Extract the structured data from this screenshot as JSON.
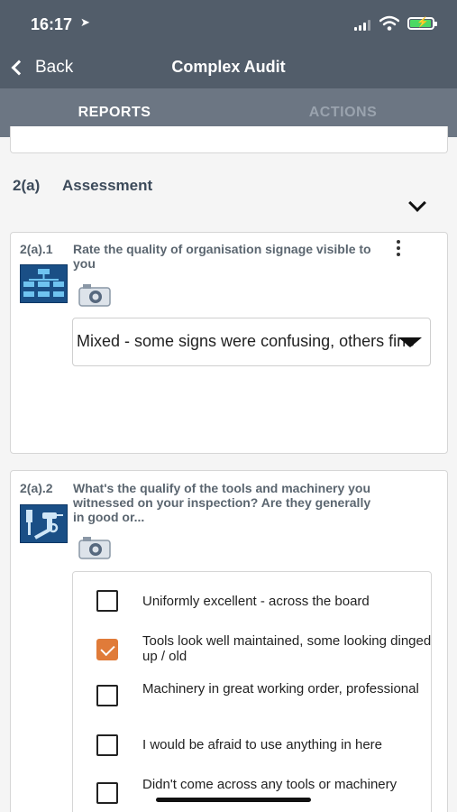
{
  "status_bar": {
    "time": "16:17"
  },
  "nav": {
    "back_label": "Back",
    "title": "Complex Audit"
  },
  "tabs": [
    {
      "label": "REPORTS",
      "active": true
    },
    {
      "label": "ACTIONS",
      "active": false
    }
  ],
  "section": {
    "code": "2(a)",
    "title": "Assessment",
    "chevron_icon": "chevron-down-icon"
  },
  "questions": [
    {
      "code": "2(a).1",
      "text": "Rate the quality of organisation signage visible to you",
      "icon": "signage-chart-icon",
      "answer_type": "select",
      "selected_value": "Mixed - some signs were confusing, others fine"
    },
    {
      "code": "2(a).2",
      "text": "What's the qualify of the tools and machinery you witnessed on your inspection? Are they generally in good or...",
      "icon": "tools-icon",
      "answer_type": "checkbox",
      "options": [
        {
          "label": "Uniformly excellent - across the board",
          "checked": false
        },
        {
          "label": "Tools look well maintained, some looking dinged up / old",
          "checked": true
        },
        {
          "label": "Machinery in great working order, professional",
          "checked": false
        },
        {
          "label": "I would be afraid to use anything in here",
          "checked": false
        },
        {
          "label": "Didn't come across any tools or machinery",
          "checked": false
        }
      ]
    }
  ],
  "colors": {
    "header": "#525d6a",
    "tabs": "#6c7683",
    "checked": "#e07b39",
    "icon_bg": "#1a4f86"
  }
}
